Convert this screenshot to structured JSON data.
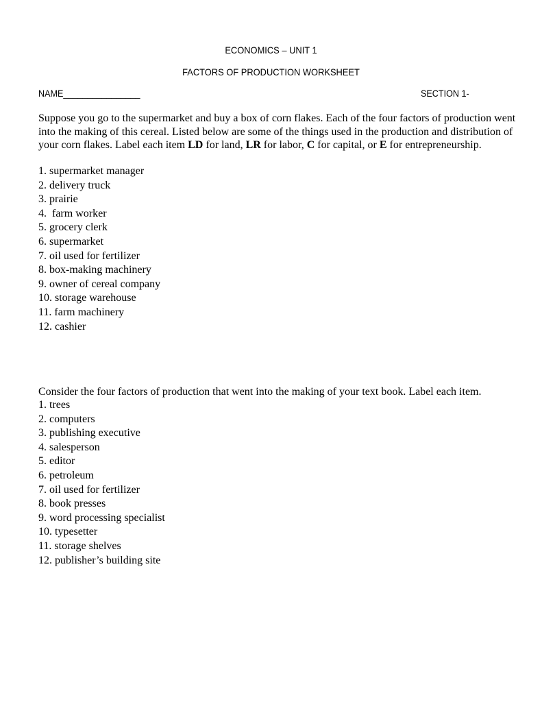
{
  "header": {
    "title": "ECONOMICS – UNIT 1",
    "subtitle": "FACTORS OF PRODUCTION WORKSHEET",
    "name_label": "NAME________________",
    "section_label": "SECTION 1-"
  },
  "part1": {
    "intro_parts": {
      "a": "Suppose you go to the supermarket and buy a box of corn flakes. Each of the four factors of production went into the making of this cereal. Listed below are some of the things used in the production and distribution of your corn flakes. Label each item ",
      "ld": "LD",
      "b": " for land, ",
      "lr": "LR",
      "c": " for labor, ",
      "cap": "C",
      "d": " for capital, or ",
      "e": "E",
      "f": " for entrepreneurship."
    },
    "items": [
      "1. supermarket manager",
      "2. delivery truck",
      "3. prairie",
      "4.  farm worker",
      "5. grocery clerk",
      "6. supermarket",
      "7. oil used for fertilizer",
      "8. box-making machinery",
      "9. owner of cereal company",
      "10. storage warehouse",
      "11. farm machinery",
      "12. cashier"
    ]
  },
  "part2": {
    "intro": "Consider the four factors of production that went into the making of your text book. Label each item.",
    "items": [
      "1. trees",
      "2. computers",
      "3. publishing executive",
      "4. salesperson",
      "5. editor",
      "6. petroleum",
      "7. oil used for fertilizer",
      "8. book presses",
      "9. word processing specialist",
      "10. typesetter",
      "11. storage shelves",
      "12. publisher’s building site"
    ]
  }
}
